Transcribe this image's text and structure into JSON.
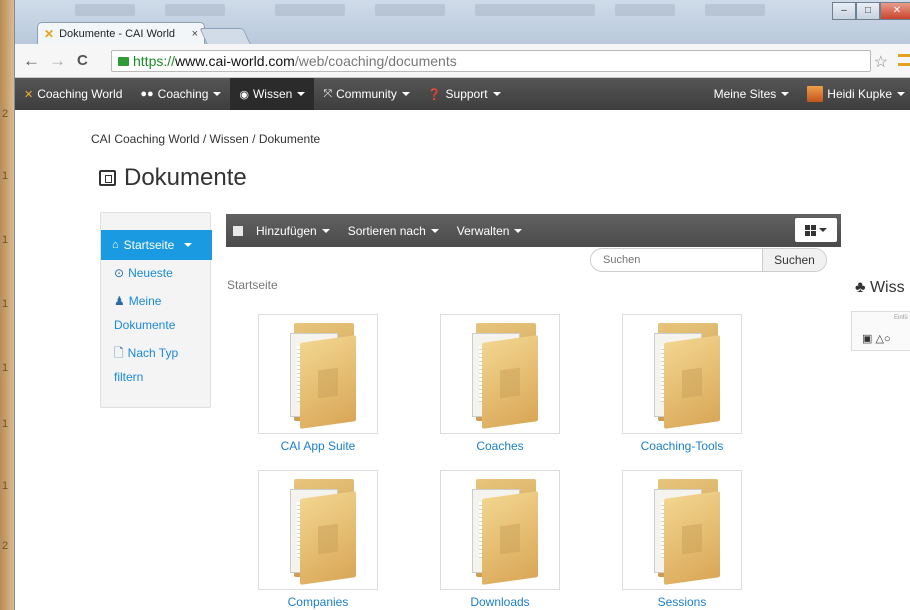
{
  "browser": {
    "tab_title": "Dokumente - CAI World",
    "tab_close": "×",
    "url_secure": "https://",
    "url_host": "www.cai-world.com",
    "url_path": "/web/coaching/documents",
    "back": "←",
    "forward": "→",
    "reload": "C",
    "bookmark": "☆"
  },
  "navbar": {
    "brand": "Coaching World",
    "items": [
      {
        "label": "Coaching",
        "icon": "people-icon"
      },
      {
        "label": "Wissen",
        "icon": "book-icon"
      },
      {
        "label": "Community",
        "icon": "expand-icon"
      },
      {
        "label": "Support",
        "icon": "question-icon"
      }
    ],
    "my_sites": "Meine Sites",
    "user": "Heidi Kupke"
  },
  "breadcrumb": "CAI Coaching World / Wissen / Dokumente",
  "page_title": "Dokumente",
  "sidebar": {
    "active": "Startseite",
    "links": [
      {
        "label": "Neueste",
        "icon": "clock-icon"
      },
      {
        "label": "Meine",
        "label2": "Dokumente",
        "icon": "user-icon"
      },
      {
        "label": "Nach Typ",
        "label2": "filtern",
        "icon": "file-icon"
      }
    ]
  },
  "toolbar": {
    "add": "Hinzufügen",
    "sort": "Sortieren nach",
    "manage": "Verwalten"
  },
  "search": {
    "placeholder": "Suchen",
    "button": "Suchen"
  },
  "section_label": "Startseite",
  "folders": [
    "CAI App Suite",
    "Coaches",
    "Coaching-Tools",
    "Companies",
    "Downloads",
    "Sessions"
  ],
  "right_panel": {
    "title": "Wiss",
    "small_text": "Einfü"
  },
  "desktop_numbers": [
    "2",
    "1",
    "1",
    "1",
    "1",
    "1",
    "1",
    "2"
  ],
  "colors": {
    "navbar": "#4a4a4a",
    "accent_blue": "#1a9ae0",
    "link_blue": "#1a7fc9",
    "secure_green": "#1a8a25"
  }
}
